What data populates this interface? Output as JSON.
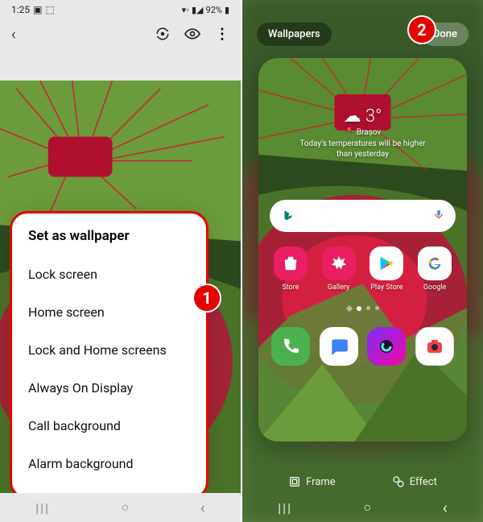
{
  "status": {
    "time": "1:25",
    "battery_pct": "92%"
  },
  "icons": {
    "back": "‹",
    "refresh": "⟳",
    "eye": "👁",
    "more": "⋮",
    "recent": "|||",
    "home": "○",
    "nav_back": "‹",
    "frame": "◈",
    "effect": "⚗",
    "cloud": "☁",
    "pin": "📍",
    "mic": "🎤"
  },
  "menu": {
    "title": "Set as wallpaper",
    "items": [
      "Lock screen",
      "Home screen",
      "Lock and Home screens",
      "Always On Display",
      "Call background",
      "Alarm background"
    ]
  },
  "step_badges": {
    "one": "1",
    "two": "2"
  },
  "right": {
    "wallpapers_btn": "Wallpapers",
    "done_btn": "Done",
    "weather": {
      "temp": "3°",
      "location": "Brașov",
      "text": "Today's temperatures will be higher than yesterday"
    },
    "apps_row1": [
      {
        "name": "Store",
        "color": "#e91e63"
      },
      {
        "name": "Gallery",
        "color": "#e91e63"
      },
      {
        "name": "Play Store",
        "color": "#fff"
      },
      {
        "name": "Google",
        "color": "#fff"
      }
    ],
    "frame_btn": "Frame",
    "effect_btn": "Effect"
  }
}
